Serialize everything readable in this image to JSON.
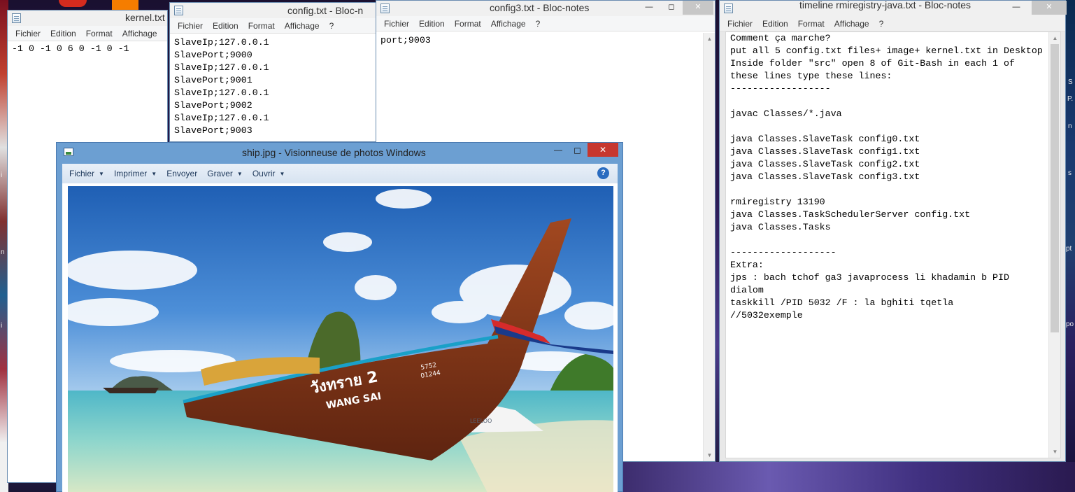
{
  "desktop": {
    "right_edge_texts": [
      "S",
      "n",
      "P.",
      "s",
      "pt",
      "po"
    ],
    "left_edge_texts": [
      "i",
      "n",
      "i"
    ]
  },
  "notepad_menu": [
    "Fichier",
    "Edition",
    "Format",
    "Affichage",
    "?"
  ],
  "windows": {
    "kernel": {
      "title": "kernel.txt",
      "content": "-1 0 -1 0 6 0 -1 0 -1"
    },
    "config": {
      "title": "config.txt - Bloc-n",
      "content": "SlaveIp;127.0.0.1\nSlavePort;9000\nSlaveIp;127.0.0.1\nSlavePort;9001\nSlaveIp;127.0.0.1\nSlavePort;9002\nSlaveIp;127.0.0.1\nSlavePort;9003"
    },
    "config3": {
      "title": "config3.txt - Bloc-notes",
      "content": "port;9003"
    },
    "timeline": {
      "title": "timeline rmiregistry-java.txt - Bloc-notes",
      "content": "Comment ça marche?\nput all 5 config.txt files+ image+ kernel.txt in Desktop\nInside folder \"src\" open 8 of Git-Bash in each 1 of\nthese lines type these lines:\n------------------\n\njavac Classes/*.java\n\njava Classes.SlaveTask config0.txt\njava Classes.SlaveTask config1.txt\njava Classes.SlaveTask config2.txt\njava Classes.SlaveTask config3.txt\n\nrmiregistry 13190\njava Classes.TaskSchedulerServer config.txt\njava Classes.Tasks\n\n-------------------\nExtra:\njps : bach tchof ga3 javaprocess li khadamin b PID\ndialom\ntaskkill /PID 5032 /F : la bghiti tqetla\n//5032exemple"
    }
  },
  "viewer": {
    "title": "ship.jpg - Visionneuse de photos Windows",
    "toolbar": {
      "fichier": "Fichier",
      "imprimer": "Imprimer",
      "envoyer": "Envoyer",
      "graver": "Graver",
      "ouvrir": "Ouvrir"
    },
    "photo": {
      "boat_name_thai": "วังทราย 2",
      "boat_name": "WANG SAI",
      "boat_number": "5752\n01244",
      "small_boat_label": "LEELOO"
    }
  },
  "colors": {
    "viewer_frame": "#6c9fd2",
    "close_button_active": "#c7372f",
    "sky": "#2f6fc0",
    "sea": "#7fd1c8",
    "boat_hull": "#8a3418"
  }
}
